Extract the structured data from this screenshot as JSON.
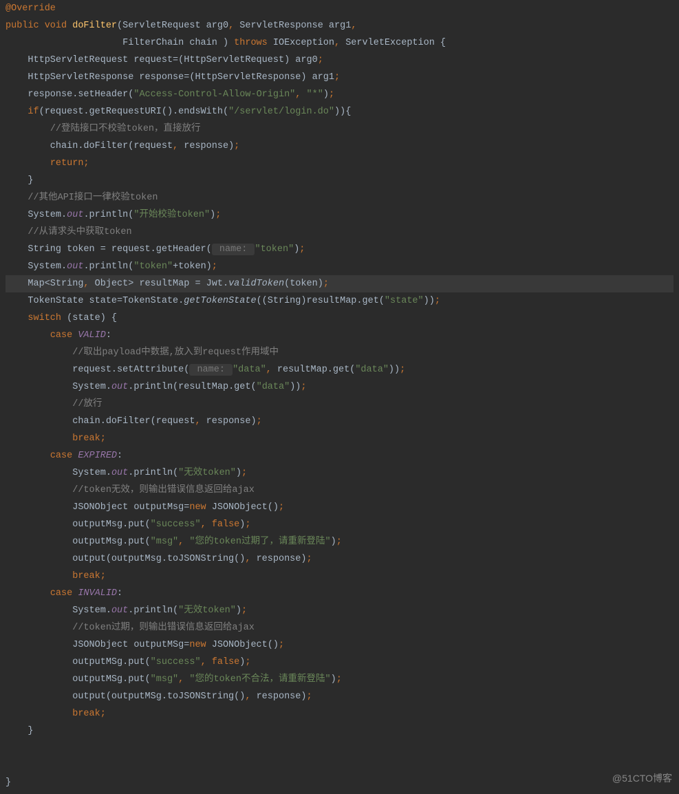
{
  "watermark": "@51CTO博客",
  "code": {
    "l1": "@Override",
    "l2_kw": "public void ",
    "l2_m": "doFilter",
    "l2_r": "(ServletRequest arg0",
    "l2_r2": " ServletResponse arg1",
    "l3_a": "                     FilterChain chain ) ",
    "l3_throws": "throws ",
    "l3_b": "IOException",
    "l3_c": " ServletException {",
    "l4": "    HttpServletRequest request=(HttpServletRequest) arg0",
    "l5": "    HttpServletResponse response=(HttpServletResponse) arg1",
    "l6_a": "    response.setHeader(",
    "l6_s1": "\"Access-Control-Allow-Origin\"",
    "l6_s2": "\"*\"",
    "l7_if": "if",
    "l7_a": "(request.getRequestURI().endsWith(",
    "l7_s": "\"/servlet/login.do\"",
    "l7_b": ")){",
    "l8_c": "//登陆接口不校验token，直接放行",
    "l9_a": "        chain.doFilter(request",
    "l9_b": " response)",
    "l10_r": "return",
    "l11": "    }",
    "l12_c": "//其他API接口一律校验token",
    "l13_a": "    System.",
    "l13_out": "out",
    "l13_b": ".println(",
    "l13_s": "\"开始校验token\"",
    "l14_c": "//从请求头中获取token",
    "l15_a": "    String token = request.getHeader(",
    "l15_p": " name: ",
    "l15_s": "\"token\"",
    "l16_a": "    System.",
    "l16_b": ".println(",
    "l16_s": "\"token\"",
    "l16_c": "+token)",
    "l17_a": "    Map<String",
    "l17_b": " Object> resultMap = Jwt.",
    "l17_m": "validToken",
    "l17_c": "(token)",
    "l18_a": "    TokenState state=TokenState.",
    "l18_m": "getTokenState",
    "l18_b": "((String)resultMap.get(",
    "l18_s": "\"state\"",
    "l18_c": "))",
    "l19_sw": "switch ",
    "l19_a": "(state) {",
    "l20_case": "case ",
    "l20_v": "VALID",
    "l21_c": "//取出payload中数据,放入到request作用域中",
    "l22_a": "            request.setAttribute(",
    "l22_p": " name: ",
    "l22_s1": "\"data\"",
    "l22_b": " resultMap.get(",
    "l22_s2": "\"data\"",
    "l22_c": "))",
    "l23_a": "            System.",
    "l23_b": ".println(resultMap.get(",
    "l23_s": "\"data\"",
    "l23_c": "))",
    "l24_c": "//放行",
    "l25_a": "            chain.doFilter(request",
    "l25_b": " response)",
    "l26_br": "break",
    "l27_v": "EXPIRED",
    "l28_a": "            System.",
    "l28_s": "\"无效token\"",
    "l29_c": "//token无效，则输出错误信息返回给ajax",
    "l30_a": "            JSONObject outputMsg=",
    "l30_new": "new ",
    "l30_b": "JSONObject()",
    "l31_a": "            outputMsg.put(",
    "l31_s": "\"success\"",
    "l31_f": "false",
    "l32_a": "            outputMsg.put(",
    "l32_s1": "\"msg\"",
    "l32_s2": "\"您的token过期了，请重新登陆\"",
    "l33_a": "            output(outputMsg.toJSONString()",
    "l33_b": " response)",
    "l34_v": "INVALID",
    "l35_c": "//token过期，则输出错误信息返回给ajax",
    "l36_a": "            JSONObject outputMSg=",
    "l37_a": "            outputMSg.put(",
    "l38_a": "            outputMSg.put(",
    "l38_s2": "\"您的token不合法，请重新登陆\"",
    "l39_a": "            output(outputMSg.toJSONString()",
    "l40": "    }",
    "l41": "}"
  }
}
